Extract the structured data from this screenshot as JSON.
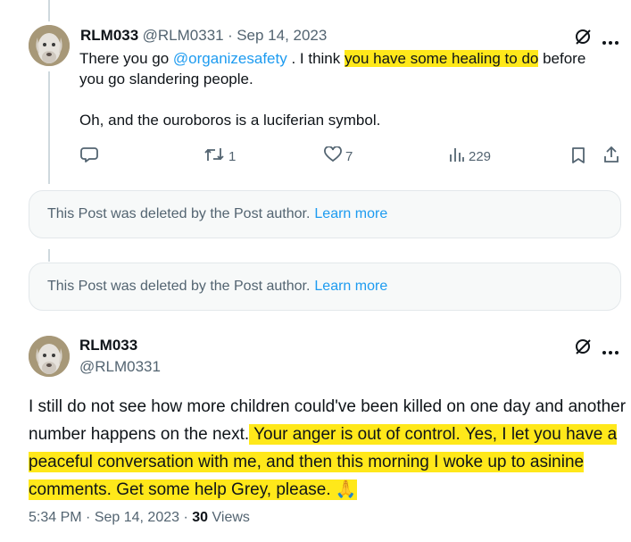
{
  "post1": {
    "name": "RLM033",
    "handle": "@RLM0331",
    "sep": "·",
    "date": "Sep 14, 2023",
    "text_a": "There you go ",
    "mention": "@organizesafety",
    "text_b": " . I think ",
    "highlight": "you have some healing to do",
    "text_c": " before",
    "line2": "you go slandering people.",
    "line3": "Oh, and the ouroboros is a luciferian symbol.",
    "reposts": "1",
    "likes": "7",
    "views": "229"
  },
  "deleted": {
    "message": "This Post was deleted by the Post author.",
    "link": "Learn more"
  },
  "post2": {
    "name": "RLM033",
    "handle": "@RLM0331",
    "text_plain": "I still do not see how more children could've been killed on one day and another number happens on the next.",
    "text_highlight": " Your anger is out of control. Yes, I let you have a peaceful conversation with me, and then this morning I woke up to asinine comments. Get some help Grey, please. ",
    "emoji": "🙏",
    "time": "5:34 PM",
    "sep": "·",
    "date": "Sep 14, 2023",
    "sep2": "·",
    "views_count": "30",
    "views_label": "Views"
  },
  "colors": {
    "accent": "#1d9bf0",
    "highlight": "#ffe81a",
    "secondary_text": "#536471"
  }
}
